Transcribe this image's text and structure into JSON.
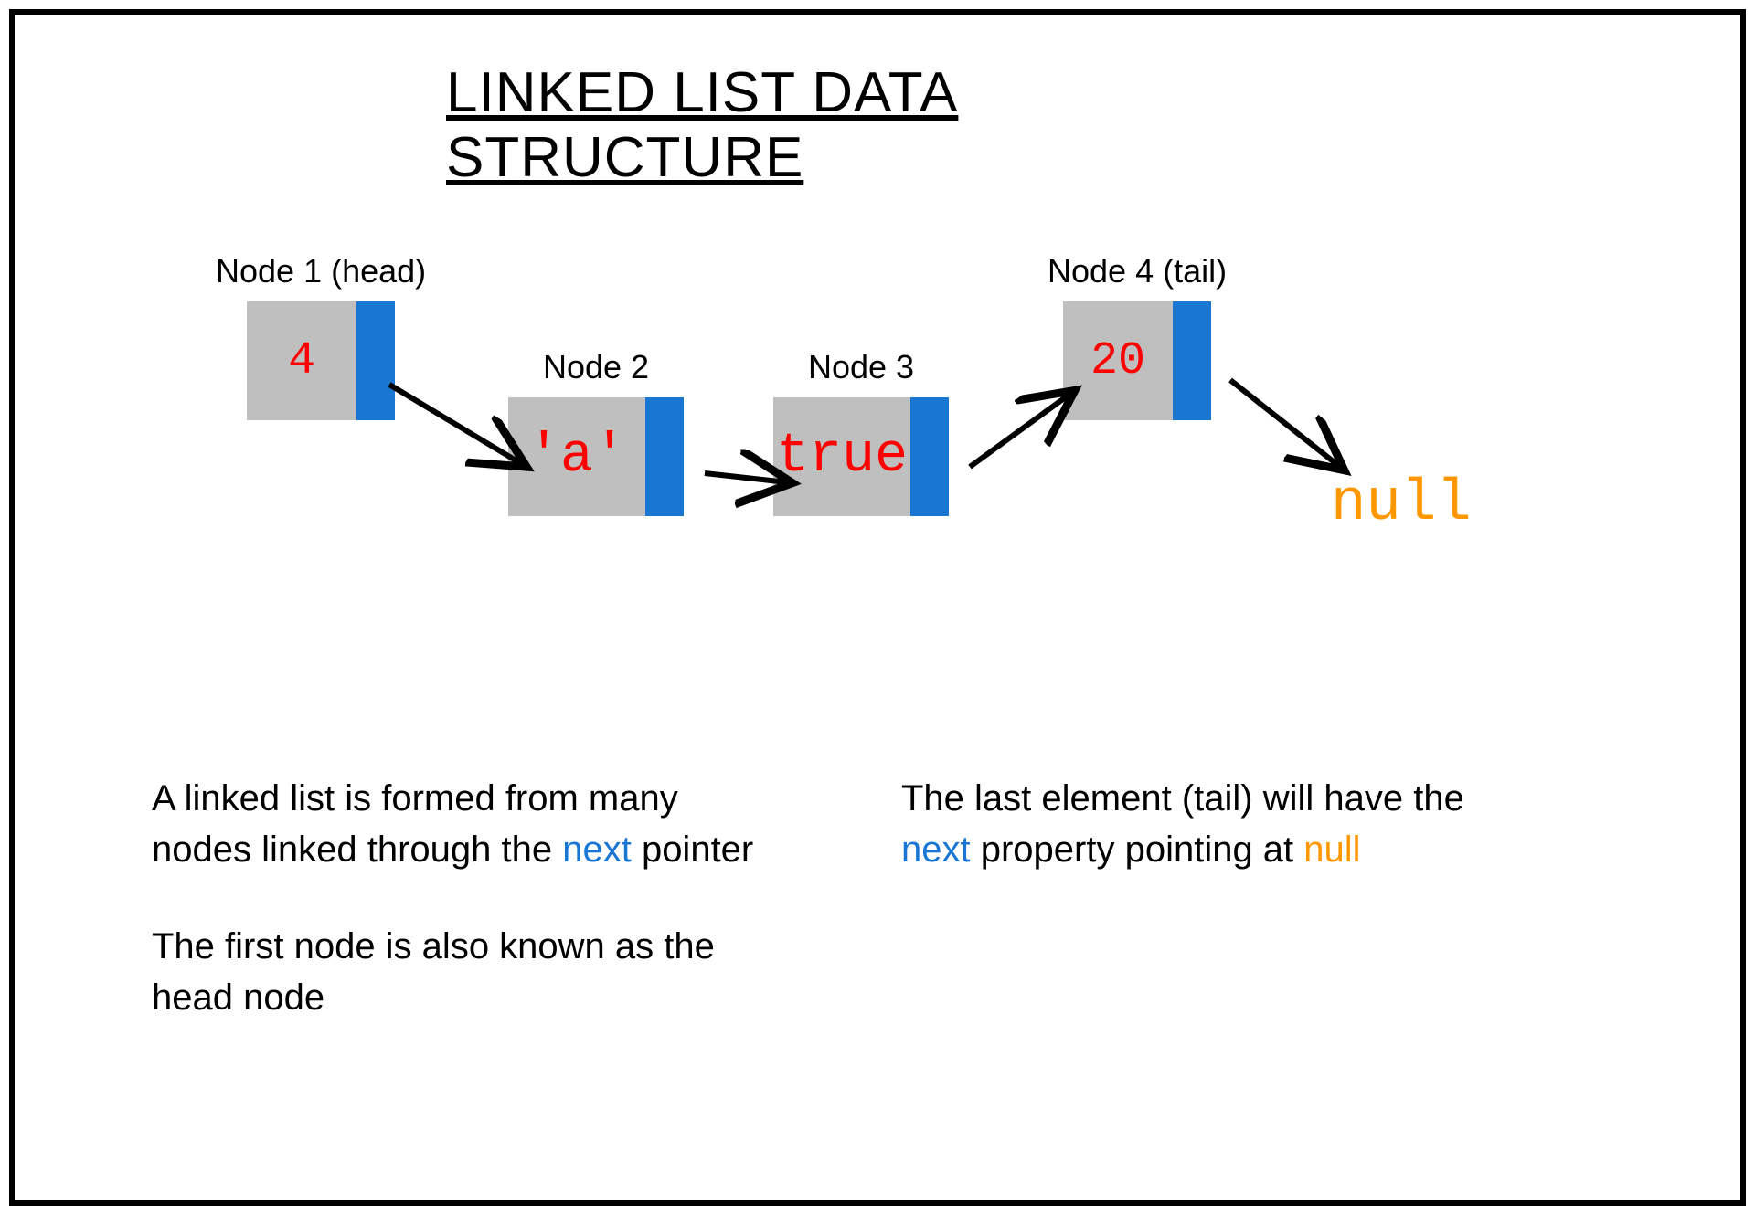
{
  "title": "LINKED LIST DATA STRUCTURE",
  "nodes": [
    {
      "label": "Node 1 (head)",
      "value": "4"
    },
    {
      "label": "Node 2",
      "value": "'a'"
    },
    {
      "label": "Node 3",
      "value": "true"
    },
    {
      "label": "Node 4 (tail)",
      "value": "20"
    }
  ],
  "null_text": "null",
  "description_left": {
    "p1_a": "A linked list is formed from many nodes linked through the ",
    "p1_highlight": "next",
    "p1_b": " pointer",
    "p2": "The first node is also known as the head node"
  },
  "description_right": {
    "p1_a": "The last element (tail) will have the ",
    "p1_h1": "next",
    "p1_b": " property pointing at ",
    "p1_h2": "null"
  },
  "colors": {
    "node_fill": "#bfbfbf",
    "pointer_fill": "#1976d2",
    "value_text": "#ff0000",
    "null_text": "#ff9800",
    "highlight_blue": "#1976d2",
    "highlight_orange": "#ff9800"
  }
}
